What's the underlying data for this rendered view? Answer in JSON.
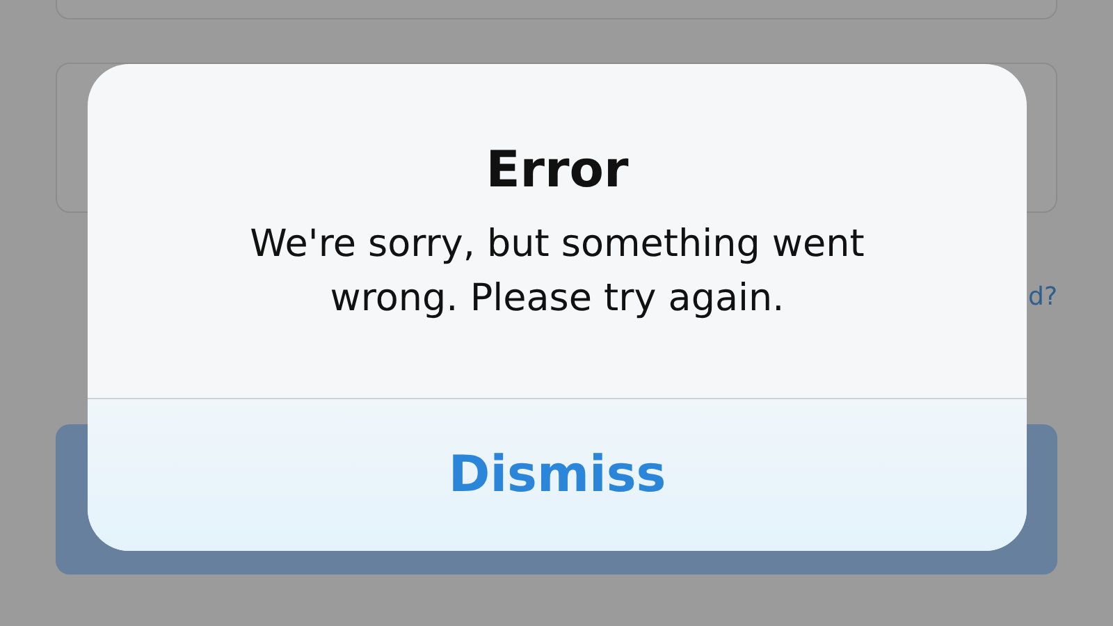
{
  "background": {
    "link": "d?"
  },
  "alert": {
    "title": "Error",
    "message": "We're sorry, but something went wrong. Please try again.",
    "button": "Dismiss"
  }
}
